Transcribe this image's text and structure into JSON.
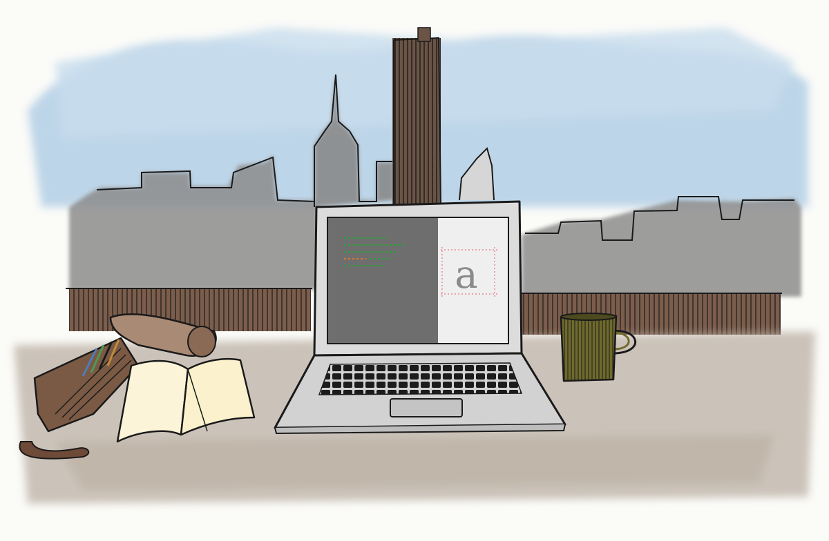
{
  "illustration": {
    "screen_glyph": "a",
    "colors": {
      "paper": "#fbfbf8",
      "sky": "#a9c9e3",
      "skyline": "#8d8d8d",
      "tower": "#6b5446",
      "rail": "#6e5445",
      "desk": "#b7ab9f",
      "laptop": "#d9d9d9",
      "screen_dark": "#6e6e6e",
      "screen_light": "#f2f2f2",
      "code_green": "#27a53a",
      "code_orange": "#e0772a",
      "guide_red": "#e0576b",
      "mug": "#6f6a2c",
      "notebook": "#fbf4d9",
      "pen_roll": "#7a5a44",
      "ink": "#1a1a1a"
    },
    "objects": [
      "city-skyline",
      "railing",
      "laptop",
      "mug",
      "pen-roll",
      "notebook"
    ]
  }
}
